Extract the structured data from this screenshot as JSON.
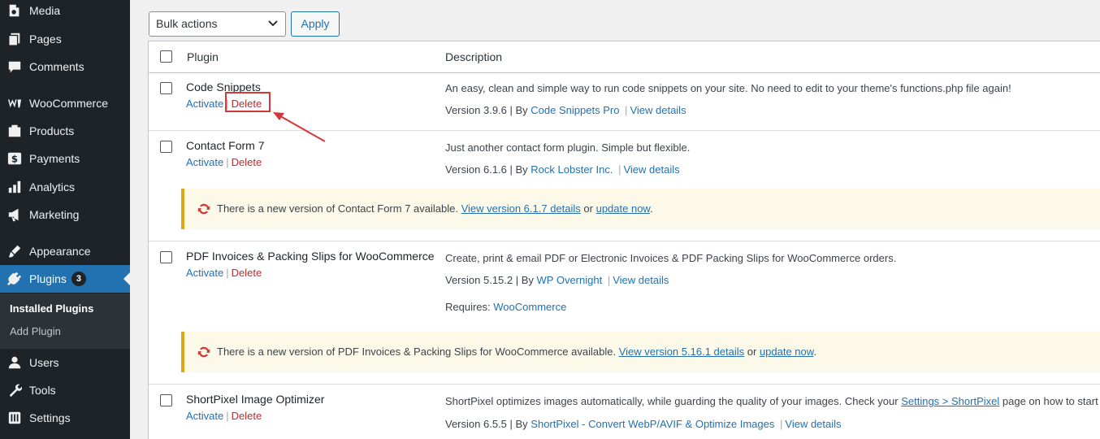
{
  "sidebar": {
    "items": [
      {
        "label": "Media",
        "icon": "media-icon"
      },
      {
        "label": "Pages",
        "icon": "pages-icon"
      },
      {
        "label": "Comments",
        "icon": "comments-icon"
      },
      {
        "label": "WooCommerce",
        "icon": "woocommerce-icon"
      },
      {
        "label": "Products",
        "icon": "products-icon"
      },
      {
        "label": "Payments",
        "icon": "payments-icon"
      },
      {
        "label": "Analytics",
        "icon": "analytics-icon"
      },
      {
        "label": "Marketing",
        "icon": "marketing-icon"
      },
      {
        "label": "Appearance",
        "icon": "appearance-icon"
      },
      {
        "label": "Plugins",
        "icon": "plugins-icon",
        "badge": "3"
      },
      {
        "label": "Users",
        "icon": "users-icon"
      },
      {
        "label": "Tools",
        "icon": "tools-icon"
      },
      {
        "label": "Settings",
        "icon": "settings-icon"
      }
    ],
    "submenu": [
      "Installed Plugins",
      "Add Plugin"
    ]
  },
  "toolbar": {
    "bulk_actions": "Bulk actions",
    "apply_label": "Apply"
  },
  "table": {
    "headers": [
      "Plugin",
      "Description"
    ],
    "activate_label": "Activate",
    "delete_label": "Delete",
    "separator": "|",
    "plugins": [
      {
        "name": "Code Snippets",
        "description": "An easy, clean and simple way to run code snippets on your site. No need to edit to your theme's functions.php file again!",
        "version": "Version 3.9.6 | By",
        "author": "Code Snippets Pro",
        "details": "View details"
      },
      {
        "name": "Contact Form 7",
        "description": "Just another contact form plugin. Simple but flexible.",
        "version": "Version 6.1.6 | By",
        "author": "Rock Lobster Inc.",
        "details": "View details",
        "notice": {
          "text": "There is a new version of Contact Form 7 available.",
          "view_link": "View version 6.1.7 details",
          "or": "or",
          "update_link": "update now",
          "end": "."
        }
      },
      {
        "name": "PDF Invoices & Packing Slips for WooCommerce",
        "description": "Create, print & email PDF or Electronic Invoices & PDF Packing Slips for WooCommerce orders.",
        "version": "Version 5.15.2 | By",
        "author": "WP Overnight",
        "details": "View details",
        "requires_label": "Requires:",
        "requires_link": "WooCommerce",
        "notice": {
          "text": "There is a new version of PDF Invoices & Packing Slips for WooCommerce available.",
          "view_link": "View version 5.16.1 details",
          "or": "or",
          "update_link": "update now",
          "end": "."
        }
      },
      {
        "name": "ShortPixel Image Optimizer",
        "description_start": "ShortPixel optimizes images automatically, while guarding the quality of your images. Check your",
        "description_link": "Settings > ShortPixel",
        "description_end": "page on how to start",
        "version": "Version 6.5.5 | By",
        "author": "ShortPixel - Convert WebP/AVIF & Optimize Images",
        "details": "View details"
      }
    ]
  },
  "colors": {
    "sidebar_bg": "#1d2327",
    "accent": "#2271b1",
    "delete": "#b32d2e",
    "notice_bg": "#fcf9e8",
    "notice_border": "#dba617",
    "highlight": "#d63638"
  }
}
